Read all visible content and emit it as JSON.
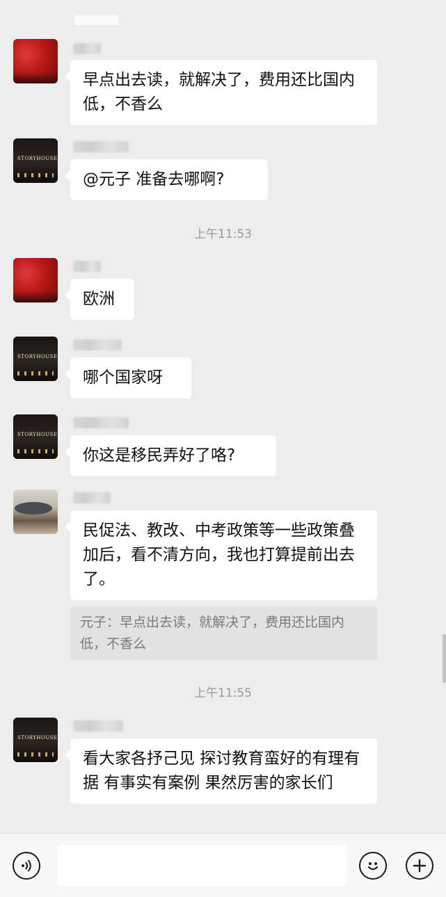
{
  "messages": [
    {
      "avatar": "red-foliage-avatar",
      "text": "早点出去读，就解决了，费用还比国内低，不香么"
    },
    {
      "avatar": "storyhouse-avatar",
      "text": "@元子  准备去哪啊?"
    },
    {
      "time": "上午11:53"
    },
    {
      "avatar": "red-foliage-avatar",
      "text": "欧洲"
    },
    {
      "avatar": "storyhouse-avatar",
      "text": "哪个国家呀"
    },
    {
      "avatar": "storyhouse-avatar",
      "text": "你这是移民弄好了咯?"
    },
    {
      "avatar": "hat-avatar",
      "text": "民促法、教改、中考政策等一些政策叠加后，看不清方向，我也打算提前出去了。",
      "quote": "元子：早点出去读，就解决了，费用还比国内低，不香么"
    },
    {
      "time": "上午11:55"
    },
    {
      "avatar": "storyhouse-avatar",
      "text": "看大家各抒己见 探讨教育蛮好的有理有据 有事实有案例 果然厉害的家长们"
    }
  ],
  "avatar_sign_text": "STORYHOUSE",
  "input": {
    "placeholder": ""
  },
  "icons": {
    "voice": "voice-icon",
    "emoji": "emoji-icon",
    "plus": "plus-icon"
  }
}
